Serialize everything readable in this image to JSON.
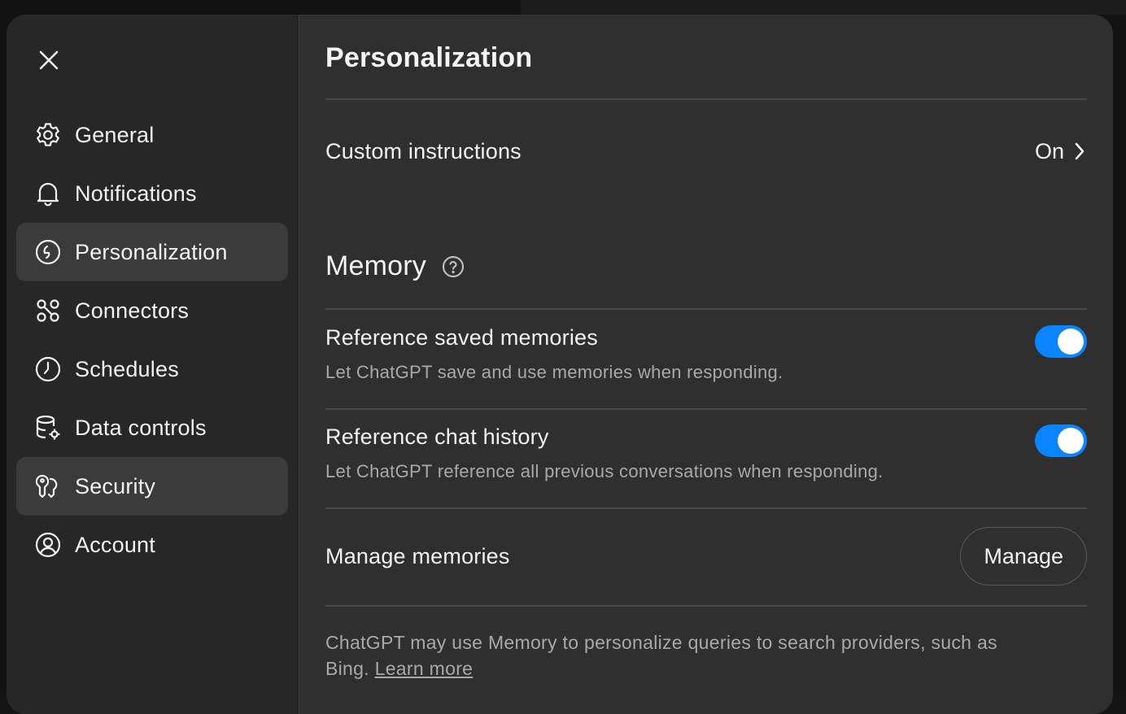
{
  "window": {
    "close_icon": "close-icon"
  },
  "sidebar": {
    "items": [
      {
        "label": "General",
        "icon": "gear-icon",
        "selected": false
      },
      {
        "label": "Notifications",
        "icon": "bell-icon",
        "selected": false
      },
      {
        "label": "Personalization",
        "icon": "personalization-icon",
        "selected": true
      },
      {
        "label": "Connectors",
        "icon": "connectors-icon",
        "selected": false
      },
      {
        "label": "Schedules",
        "icon": "clock-icon",
        "selected": false
      },
      {
        "label": "Data controls",
        "icon": "database-gear-icon",
        "selected": false
      },
      {
        "label": "Security",
        "icon": "key-icon",
        "selected": false
      },
      {
        "label": "Account",
        "icon": "user-circle-icon",
        "selected": false
      }
    ]
  },
  "main": {
    "title": "Personalization",
    "custom_instructions": {
      "label": "Custom instructions",
      "value": "On"
    },
    "memory": {
      "heading": "Memory",
      "help_icon": "help-circle-icon",
      "settings": [
        {
          "label": "Reference saved memories",
          "description": "Let ChatGPT save and use memories when responding.",
          "enabled": true
        },
        {
          "label": "Reference chat history",
          "description": "Let ChatGPT reference all previous conversations when responding.",
          "enabled": true
        }
      ],
      "manage": {
        "label": "Manage memories",
        "button_label": "Manage"
      },
      "footnote": {
        "text": "ChatGPT may use Memory to personalize queries to search providers, such as Bing. ",
        "link": "Learn more"
      }
    }
  },
  "colors": {
    "toggle_on": "#0a84ff",
    "dialog_bg": "#2f2f2f",
    "sidebar_bg": "#272727",
    "selected_item_bg": "#3b3b3b"
  }
}
